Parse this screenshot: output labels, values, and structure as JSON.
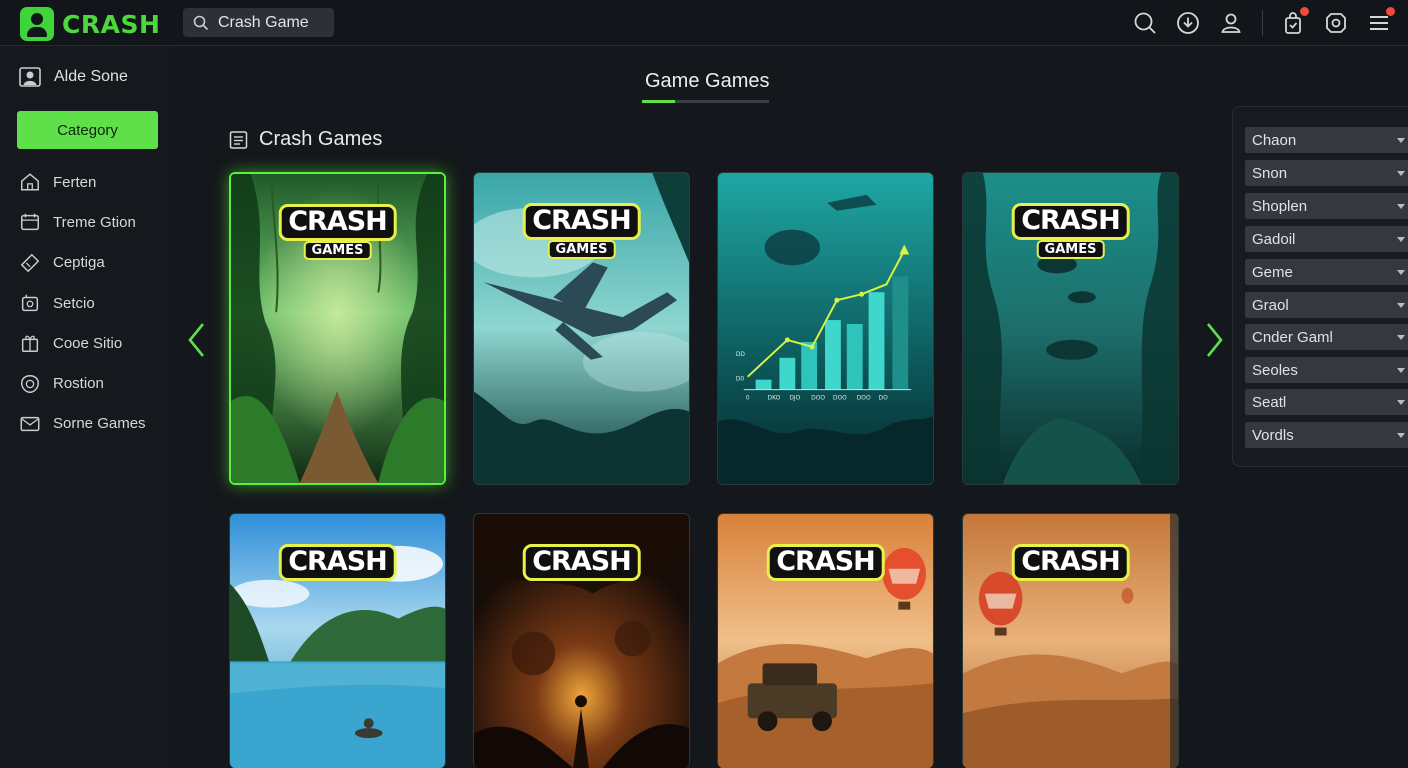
{
  "brand": {
    "logo_text": "CRASH",
    "accent": "#5fe04a"
  },
  "search": {
    "value": "Crash Game"
  },
  "top_icons": [
    "search-icon",
    "download-icon",
    "user-icon",
    "bag-icon",
    "settings-icon",
    "menu-icon"
  ],
  "sidebar": {
    "user_label": "Alde Sone",
    "category_button": "Category",
    "items": [
      {
        "label": "Ferten",
        "icon": "home-icon"
      },
      {
        "label": "Treme Gtion",
        "icon": "tools-icon"
      },
      {
        "label": "Ceptiga",
        "icon": "tag-icon"
      },
      {
        "label": "Setcio",
        "icon": "gear-icon"
      },
      {
        "label": "Cooe Sitio",
        "icon": "gift-icon"
      },
      {
        "label": "Rostion",
        "icon": "shield-icon"
      },
      {
        "label": "Sorne Games",
        "icon": "mail-icon"
      }
    ]
  },
  "main": {
    "tab_title": "Game Games",
    "section_title": "Crash Games",
    "cards": [
      {
        "scene": "jungle",
        "badge": "CRASH",
        "badge_sub": "GAMES",
        "selected": true
      },
      {
        "scene": "airplane",
        "badge": "CRASH",
        "badge_sub": "GAMES",
        "selected": false
      },
      {
        "scene": "chart",
        "badge": "",
        "badge_sub": "",
        "selected": false,
        "chart_labels": [
          "0",
          "DKO",
          "DJO",
          "DOO",
          "DOO",
          "DOO",
          "DO"
        ],
        "axis_labels": [
          "DD",
          "D0"
        ]
      },
      {
        "scene": "underwater",
        "badge": "CRASH",
        "badge_sub": "GAMES",
        "selected": false
      },
      {
        "scene": "lake",
        "badge": "CRASH",
        "badge_sub": "",
        "selected": false
      },
      {
        "scene": "cave",
        "badge": "CRASH",
        "badge_sub": "",
        "selected": false
      },
      {
        "scene": "desert-truck",
        "badge": "CRASH",
        "badge_sub": "",
        "selected": false
      },
      {
        "scene": "desert-balloon",
        "badge": "CRASH",
        "badge_sub": "",
        "selected": false
      }
    ]
  },
  "filters": [
    "Chaon",
    "Snon",
    "Shoplen",
    "Gadoil",
    "Geme",
    "Graol",
    "Cnder Gaml",
    "Seoles",
    "Seatl",
    "Vordls"
  ]
}
